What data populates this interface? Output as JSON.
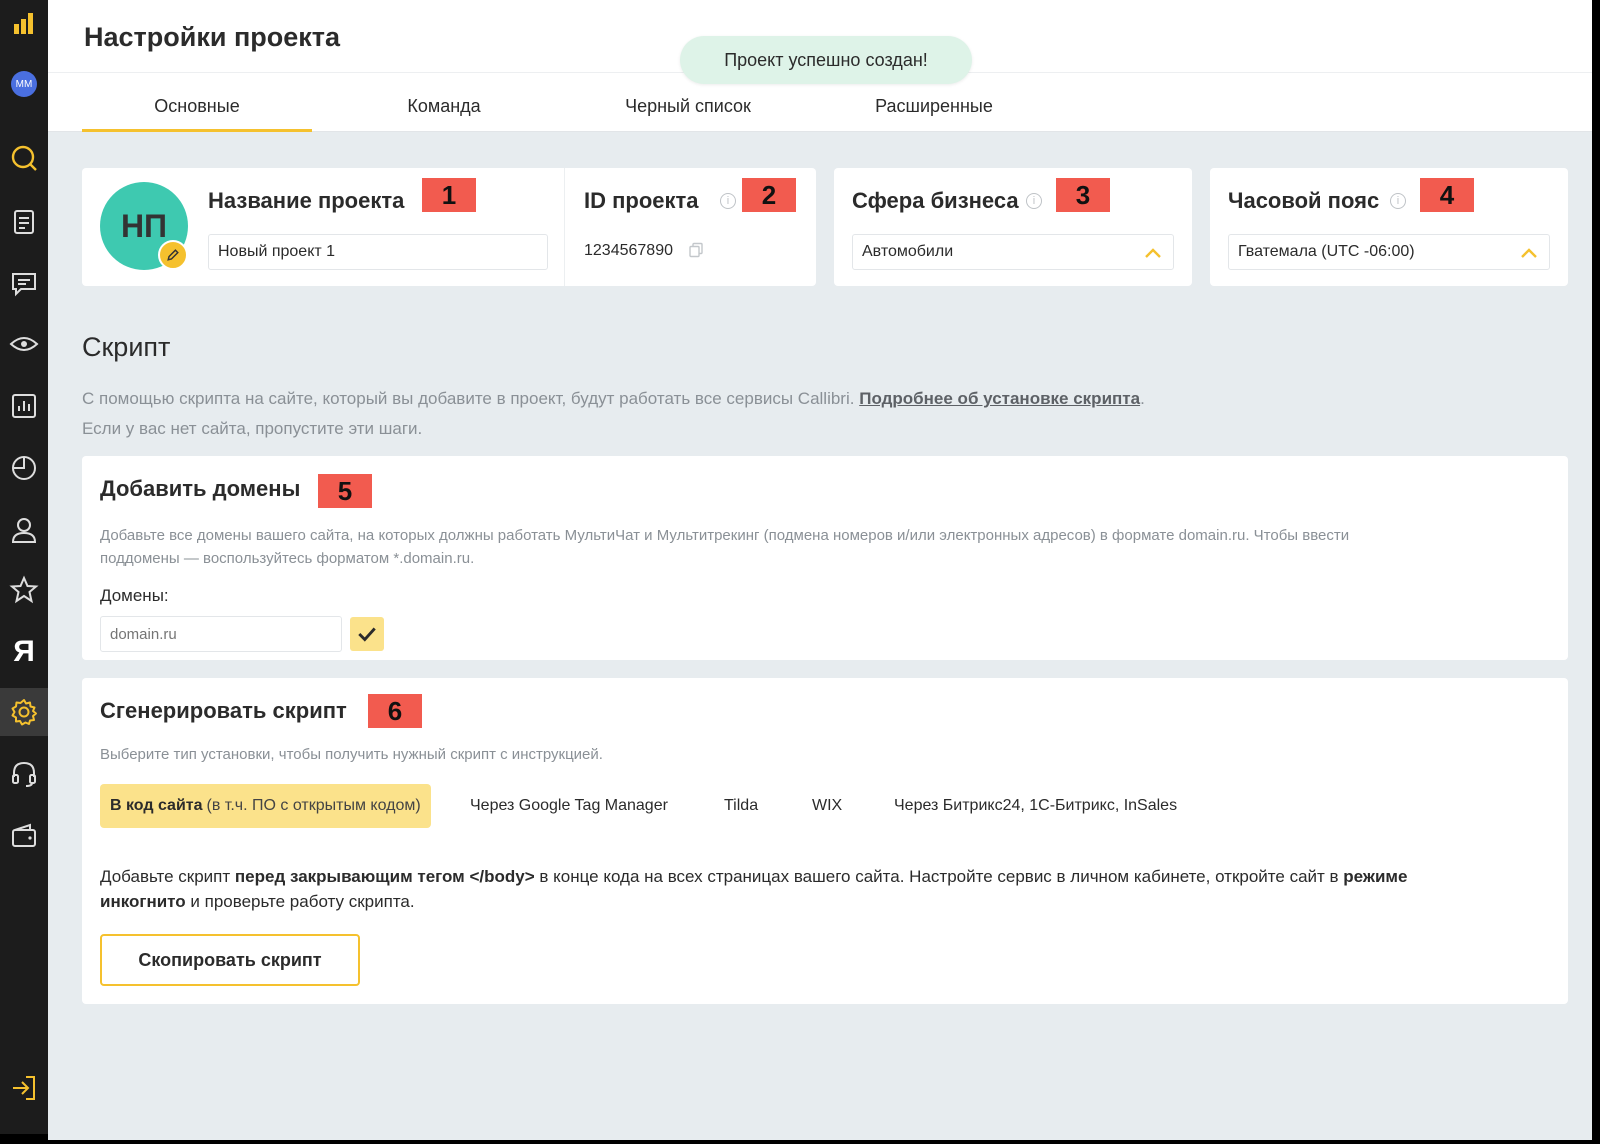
{
  "sidebar": {
    "avatar": "MM",
    "yandex": "Я",
    "icons": [
      "logo-bars-icon",
      "avatar",
      "search-icon",
      "document-icon",
      "chat-icon",
      "eye-icon",
      "chart-icon",
      "pie-icon",
      "user-icon",
      "star-icon",
      "yandex-icon",
      "gear-icon",
      "headset-icon",
      "wallet-icon",
      "logout-icon"
    ],
    "accent": "#f5c12e"
  },
  "header": {
    "title": "Настройки проекта",
    "toast": "Проект успешно создан!",
    "tabs": [
      "Основные",
      "Команда",
      "Черный список",
      "Расширенные"
    ]
  },
  "project": {
    "avatar_initials": "НП",
    "name_label": "Название проекта",
    "name_value": "Новый проект 1",
    "id_label": "ID проекта",
    "id_value": "1234567890",
    "business_label": "Сфера бизнеса",
    "business_value": "Автомобили",
    "timezone_label": "Часовой пояс",
    "timezone_value": "Гватемала (UTC -06:00)"
  },
  "badges": [
    "1",
    "2",
    "3",
    "4",
    "5",
    "6"
  ],
  "script": {
    "title": "Скрипт",
    "desc_line1": "С помощью скрипта на сайте, который вы добавите в проект, будут работать все сервисы Callibri.",
    "desc_link": "Подробнее об установке скрипта",
    "desc_line1_end": ".",
    "desc_line2": "Если у вас нет сайта, пропустите эти шаги."
  },
  "domains": {
    "title": "Добавить домены",
    "desc_line1": "Добавьте все домены вашего сайта, на которых должны работать МультиЧат и Мультитрекинг (подмена номеров и/или электронных адресов) в формате domain.ru. Чтобы ввести",
    "desc_line2": "поддомены — воспользуйтесь форматом *.domain.ru.",
    "field_label": "Домены:",
    "placeholder": "domain.ru"
  },
  "generate": {
    "title": "Сгенерировать скрипт",
    "desc": "Выберите тип установки, чтобы получить нужный скрипт с инструкцией.",
    "options": {
      "site_code": "В код сайта",
      "site_code_sub": "(в т.ч. ПО с открытым кодом)",
      "gtm": "Через Google Tag Manager",
      "tilda": "Tilda",
      "wix": "WIX",
      "bitrix": "Через Битрикс24, 1С-Битрикс, InSales"
    },
    "instr_a": "Добавьте скрипт ",
    "instr_b": "перед закрывающим тегом </body>",
    "instr_c": " в конце кода на всех страницах вашего сайта. Настройте сервис в личном кабинете, откройте сайт в ",
    "instr_d": "режиме",
    "instr_e": "инкогнито",
    "instr_f": " и проверьте работу скрипта.",
    "copy_button": "Скопировать скрипт"
  }
}
